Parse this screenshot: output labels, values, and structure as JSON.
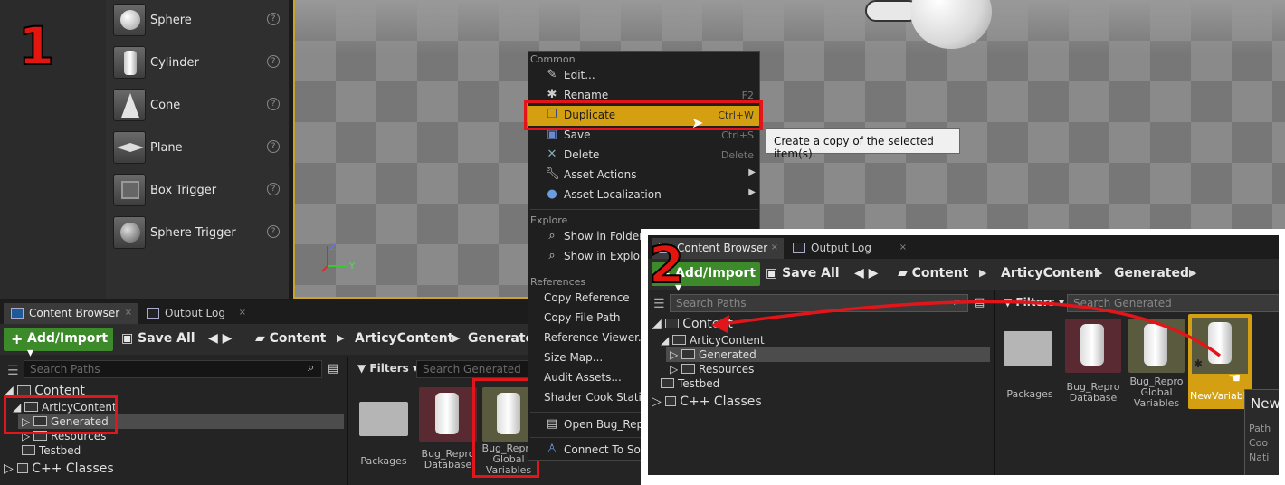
{
  "steps": {
    "one": "1",
    "two": "2"
  },
  "place_items": [
    {
      "label": "Sphere",
      "help": "?"
    },
    {
      "label": "Cylinder",
      "help": "?"
    },
    {
      "label": "Cone",
      "help": "?"
    },
    {
      "label": "Plane",
      "help": "?"
    },
    {
      "label": "Box Trigger",
      "help": "?"
    },
    {
      "label": "Sphere Trigger",
      "help": "?"
    }
  ],
  "viewport": {
    "axis_z": "Z",
    "axis_y": "Y"
  },
  "cb1": {
    "tabs": [
      {
        "label": "Content Browser",
        "close": "×"
      },
      {
        "label": "Output Log",
        "close": "×"
      }
    ],
    "add_import": "Add/Import",
    "save_all": "Save All",
    "breadcrumb": [
      "Content",
      "ArticyContent",
      "Generated"
    ],
    "search_paths": "Search Paths",
    "filters": "Filters",
    "search_generated": "Search Generated",
    "tree": {
      "content": "Content",
      "articy": "ArticyContent",
      "generated": "Generated",
      "resources": "Resources",
      "testbed": "Testbed",
      "cpp": "C++ Classes"
    },
    "assets": [
      {
        "label": "Packages"
      },
      {
        "label": "Bug_Repro Database"
      },
      {
        "label": "Bug_Repro Global Variables"
      }
    ]
  },
  "menu": {
    "common": "Common",
    "explore": "Explore",
    "references": "References",
    "items": {
      "edit": "Edit...",
      "rename": "Rename",
      "rename_sc": "F2",
      "duplicate": "Duplicate",
      "duplicate_sc": "Ctrl+W",
      "save": "Save",
      "save_sc": "Ctrl+S",
      "delete": "Delete",
      "delete_sc": "Delete",
      "asset_actions": "Asset Actions",
      "asset_localization": "Asset Localization",
      "show_in_folder": "Show in Folder",
      "show_in_explorer": "Show in Explore",
      "copy_reference": "Copy Reference",
      "copy_file_path": "Copy File Path",
      "reference_viewer": "Reference Viewer...",
      "size_map": "Size Map...",
      "audit_assets": "Audit Assets...",
      "shader_cook": "Shader Cook Statist",
      "open_bug": "Open Bug_Repr",
      "connect": "Connect To Sou"
    }
  },
  "tooltip": "Create a copy of the selected item(s).",
  "cb2": {
    "tabs": [
      {
        "label": "Content Browser",
        "close": "×"
      },
      {
        "label": "Output Log",
        "close": "×"
      }
    ],
    "add_import": "Add/Import",
    "save_all": "Save All",
    "breadcrumb": [
      "Content",
      "ArticyContent",
      "Generated"
    ],
    "search_paths": "Search Paths",
    "filters": "Filters",
    "search_generated": "Search Generated",
    "tree": {
      "content": "Content",
      "articy": "ArticyContent",
      "generated": "Generated",
      "resources": "Resources",
      "testbed": "Testbed",
      "cpp": "C++ Classes"
    },
    "assets": [
      {
        "label": "Packages"
      },
      {
        "label": "Bug_Repro Database"
      },
      {
        "label": "Bug_Repro Global Variables"
      },
      {
        "label": "NewVariable"
      }
    ],
    "side_panel": {
      "title": "New",
      "line1": "Path",
      "line2": "Coo",
      "line3": "Nati"
    }
  },
  "colors": {
    "accent": "#d4a012",
    "annotation": "#e2151a",
    "add_button": "#3d8a2a"
  }
}
